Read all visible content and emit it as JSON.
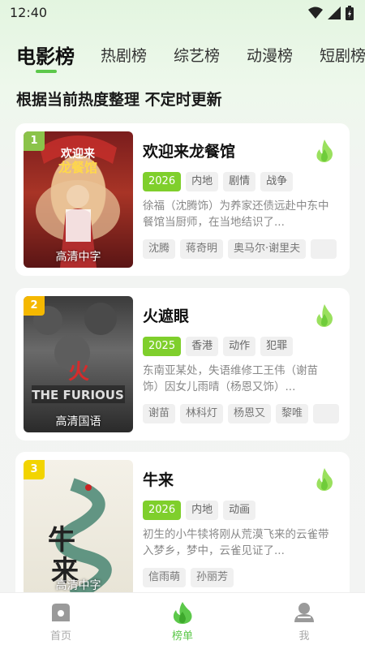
{
  "status": {
    "time": "12:40"
  },
  "tabs": [
    {
      "label": "电影榜",
      "active": true
    },
    {
      "label": "热剧榜",
      "active": false
    },
    {
      "label": "综艺榜",
      "active": false
    },
    {
      "label": "动漫榜",
      "active": false
    },
    {
      "label": "短剧榜",
      "active": false
    }
  ],
  "subtitle": "根据当前热度整理 不定时更新",
  "items": [
    {
      "rank": "1",
      "title": "欢迎来龙餐馆",
      "quality": "高清中字",
      "year": "2026",
      "tags": [
        "内地",
        "剧情",
        "战争"
      ],
      "desc": "徐福（沈腾饰）为养家还债远赴中东中餐馆当厨师，在当地结识了...",
      "actors": [
        "沈腾",
        "蒋奇明",
        "奥马尔·谢里夫"
      ]
    },
    {
      "rank": "2",
      "title": "火遮眼",
      "quality": "高清国语",
      "year": "2025",
      "tags": [
        "香港",
        "动作",
        "犯罪"
      ],
      "desc": "东南亚某处，失语维修工王伟（谢苗饰）因女儿雨晴（杨恩又饰）...",
      "actors": [
        "谢苗",
        "林科灯",
        "杨恩又",
        "黎唯"
      ]
    },
    {
      "rank": "3",
      "title": "牛来",
      "quality": "高清中字",
      "year": "2026",
      "tags": [
        "内地",
        "动画"
      ],
      "desc": "初生的小牛犊将刚从荒漠飞来的云雀带入梦乡，梦中，云雀见证了...",
      "actors": [
        "信雨萌",
        "孙丽芳"
      ]
    }
  ],
  "bottom_nav": [
    {
      "label": "首页",
      "icon": "home-icon"
    },
    {
      "label": "榜单",
      "icon": "flame-icon",
      "active": true
    },
    {
      "label": "我",
      "icon": "user-icon"
    }
  ],
  "colors": {
    "accent": "#5cc84a",
    "year_tag": "#7fcf2c",
    "rank1": "#8bc34a",
    "rank2": "#f5b800",
    "rank3": "#f2d400"
  }
}
